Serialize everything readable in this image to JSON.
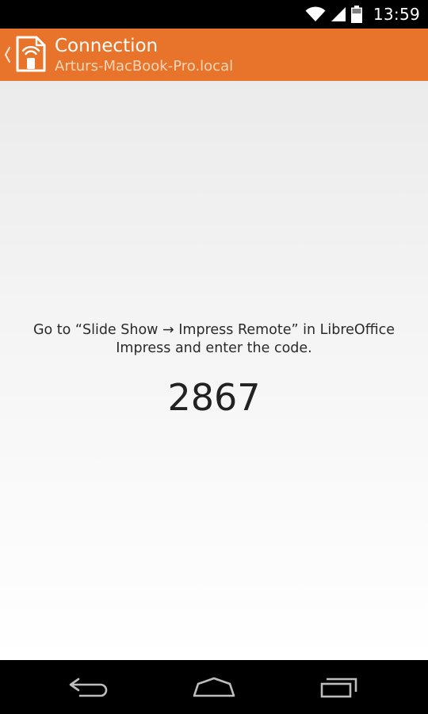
{
  "status_bar": {
    "time": "13:59",
    "icons": [
      "wifi-icon",
      "signal-icon",
      "battery-icon"
    ]
  },
  "action_bar": {
    "title": "Connection",
    "subtitle": "Arturs-MacBook-Pro.local",
    "icons": [
      "back-chevron-icon",
      "impress-remote-app-icon"
    ]
  },
  "content": {
    "instructions": "Go to “Slide Show → Impress Remote” in LibreOffice Impress and enter the code.",
    "pin": "2867"
  },
  "nav_bar": {
    "icons": [
      "back-icon",
      "home-icon",
      "recents-icon"
    ]
  },
  "colors": {
    "action_bar": "#e8732a",
    "status_bar": "#000000",
    "nav_bar": "#000000"
  }
}
